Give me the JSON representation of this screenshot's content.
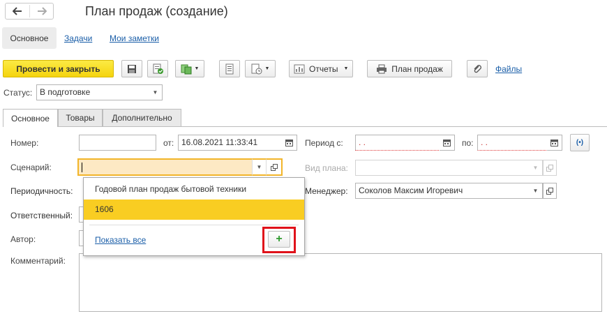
{
  "window": {
    "title": "План продаж (создание)"
  },
  "nav_tabs": [
    "Основное",
    "Задачи",
    "Мои заметки"
  ],
  "toolbar": {
    "post_close": "Провести и закрыть",
    "reports": "Отчеты",
    "sales_plan": "План продаж",
    "files": "Файлы"
  },
  "status": {
    "label": "Статус:",
    "value": "В подготовке"
  },
  "form_tabs": [
    "Основное",
    "Товары",
    "Дополнительно"
  ],
  "fields": {
    "number_label": "Номер:",
    "from_label": "от:",
    "date": "16.08.2021 11:33:41",
    "period_label": "Период с:",
    "period_from": " .  .",
    "to_label": "по:",
    "period_to": " .  .",
    "scenario_label": "Сценарий:",
    "plan_type_label": "Вид плана:",
    "periodicity_label": "Периодичность:",
    "manager_label": "Менеджер:",
    "manager_value": "Соколов Максим Игоревич",
    "responsible_label": "Ответственный:",
    "author_label": "Автор:",
    "comment_label": "Комментарий:"
  },
  "dropdown": {
    "items": [
      "Годовой план продаж бытовой техники",
      "1606"
    ],
    "selected_index": 1,
    "show_all": "Показать все",
    "add_glyph": "+"
  },
  "colors": {
    "accent_yellow": "#f9cd22",
    "field_focus": "#fde9c4",
    "highlight_red": "#e0121a",
    "link": "#1a5ea8"
  }
}
